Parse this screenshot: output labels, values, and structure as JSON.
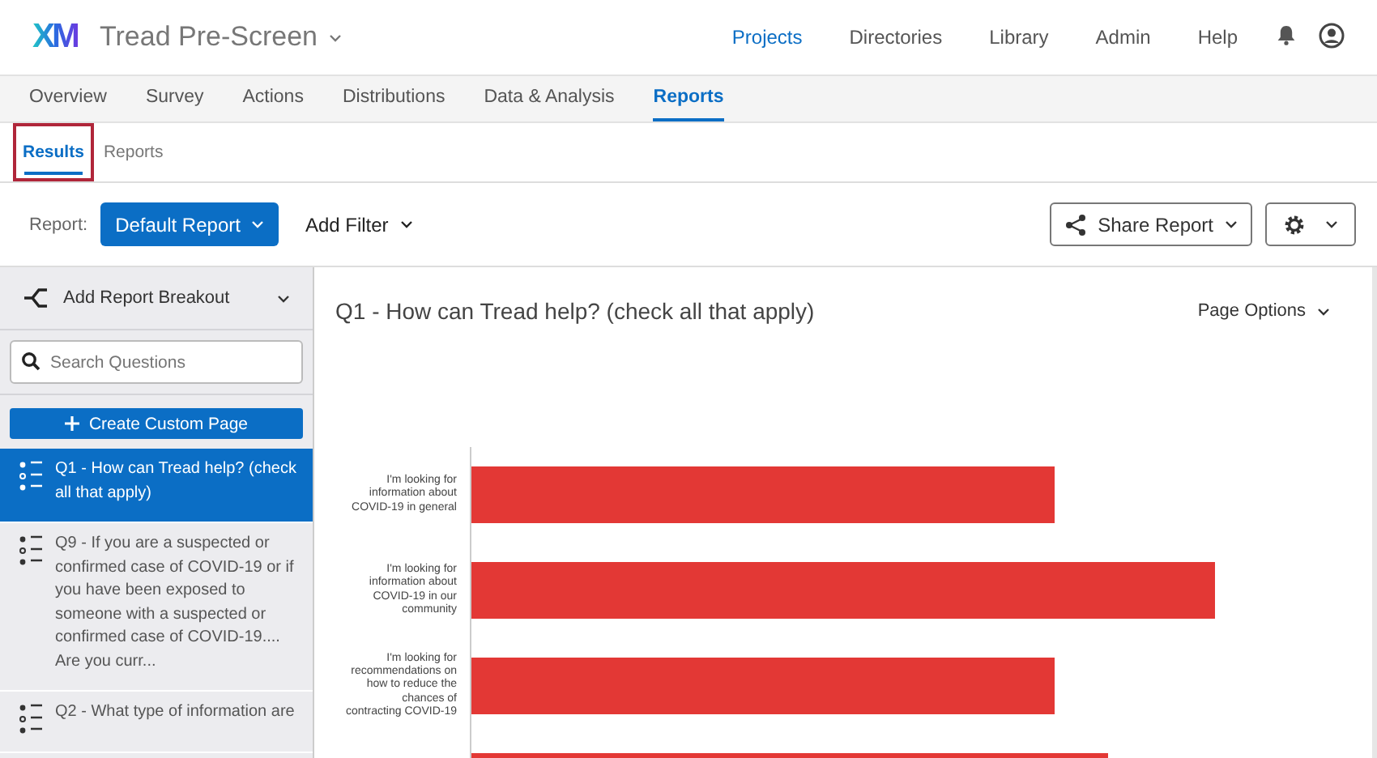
{
  "header": {
    "logo": "XM",
    "project_title": "Tread Pre-Screen",
    "links": [
      {
        "label": "Projects",
        "selected": true
      },
      {
        "label": "Directories",
        "selected": false
      },
      {
        "label": "Library",
        "selected": false
      },
      {
        "label": "Admin",
        "selected": false
      },
      {
        "label": "Help",
        "selected": false
      }
    ]
  },
  "tabs": [
    {
      "label": "Overview",
      "selected": false
    },
    {
      "label": "Survey",
      "selected": false
    },
    {
      "label": "Actions",
      "selected": false
    },
    {
      "label": "Distributions",
      "selected": false
    },
    {
      "label": "Data & Analysis",
      "selected": false
    },
    {
      "label": "Reports",
      "selected": true
    }
  ],
  "subtabs": [
    {
      "label": "Results",
      "selected": true,
      "highlighted": true
    },
    {
      "label": "Reports",
      "selected": false,
      "highlighted": false
    }
  ],
  "toolbar": {
    "report_label": "Report:",
    "report_button": "Default Report",
    "filter_button": "Add Filter",
    "share_button": "Share Report"
  },
  "sidebar": {
    "breakout": "Add Report Breakout",
    "search": {
      "placeholder": "Search Questions"
    },
    "create_button": "Create Custom Page",
    "items": [
      {
        "label": "Q1 - How can Tread help? (check all that apply)",
        "selected": true
      },
      {
        "label": "Q9 - If you are a suspected or confirmed case of COVID-19 or if you have been exposed to someone with a suspected or confirmed case of COVID-19.... Are you curr...",
        "selected": false
      },
      {
        "label": "Q2 - What type of information are",
        "selected": false
      }
    ]
  },
  "main": {
    "title": "Q1 - How can Tread help? (check all that apply)",
    "page_options": "Page Options",
    "bar_labels": [
      "I'm looking for information about COVID-19 in general",
      "I'm looking for information about COVID-19 in our community",
      "I'm looking for recommendations on how to reduce the chances of contracting COVID-19"
    ]
  }
}
